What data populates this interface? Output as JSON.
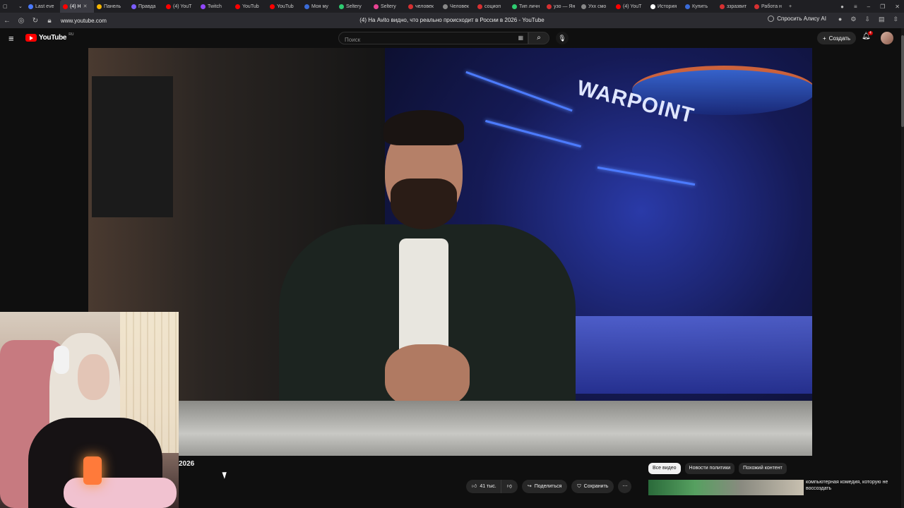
{
  "browser": {
    "tabs": [
      {
        "label": "Last eve",
        "color": "#4a7aff"
      },
      {
        "label": "(4) Н",
        "color": "#ff0000",
        "active": true
      },
      {
        "label": "Панель",
        "color": "#f5b400"
      },
      {
        "label": "Правда",
        "color": "#7b5cff"
      },
      {
        "label": "(4) YouT",
        "color": "#ff0000"
      },
      {
        "label": "Twitch",
        "color": "#9146ff"
      },
      {
        "label": "YouTub",
        "color": "#ff0000"
      },
      {
        "label": "YouTub",
        "color": "#ff0000"
      },
      {
        "label": "Моя му",
        "color": "#3a6bd8"
      },
      {
        "label": "Selterу",
        "color": "#2ecc71"
      },
      {
        "label": "Selterу",
        "color": "#e84393"
      },
      {
        "label": "человек",
        "color": "#d63031"
      },
      {
        "label": "Человек",
        "color": "#888888"
      },
      {
        "label": "социоп",
        "color": "#d63031"
      },
      {
        "label": "Тип личн",
        "color": "#2ecc71"
      },
      {
        "label": "узо — Ян",
        "color": "#d63031"
      },
      {
        "label": "Ухх смо",
        "color": "#888888"
      },
      {
        "label": "(4) YouT",
        "color": "#ff0000"
      },
      {
        "label": "История",
        "color": "#ffffff"
      },
      {
        "label": "Купить",
        "color": "#3a6bd8"
      },
      {
        "label": "ззразвит",
        "color": "#d63031"
      },
      {
        "label": "Работа н",
        "color": "#d63031"
      }
    ],
    "tab_close": "✕",
    "new_tab": "+",
    "url": "www.youtube.com",
    "page_title": "(4) На Avito видно, что реально происходит в России в 2026 - YouTube",
    "alice_label": "Спросить Алису AI"
  },
  "youtube": {
    "logo_text": "YouTube",
    "logo_region": "RU",
    "search_placeholder": "Поиск",
    "create_label": "Создать",
    "notif_count": "4"
  },
  "video": {
    "neon_sign": "WARPOINT",
    "title_fragment": "2026"
  },
  "chips": [
    "Все видео",
    "Новости политики",
    "Похожий контент"
  ],
  "actions": {
    "likes": "41 тыс.",
    "share": "Поделиться",
    "save": "Сохранить"
  },
  "recommendation": {
    "title": "компьютерная комедия, которую не воссоздать"
  }
}
